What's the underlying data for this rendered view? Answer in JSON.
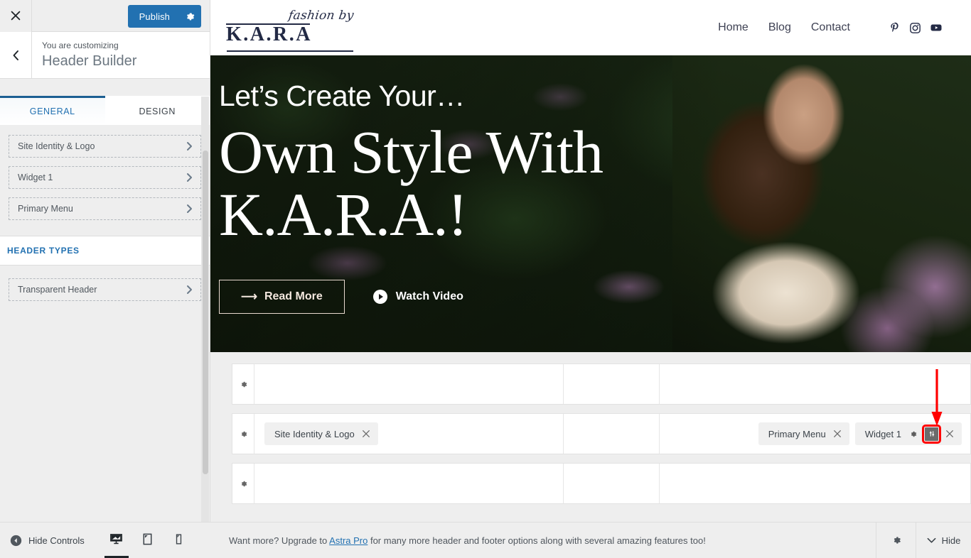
{
  "customizer": {
    "close_icon": "close-icon",
    "publish_label": "Publish",
    "publish_gear_icon": "gear-icon",
    "back_icon": "chevron-left-icon",
    "pretitle": "You are customizing",
    "title": "Header Builder",
    "tabs": [
      {
        "label": "GENERAL",
        "active": true
      },
      {
        "label": "DESIGN",
        "active": false
      }
    ],
    "items": [
      {
        "label": "Site Identity & Logo"
      },
      {
        "label": "Widget 1"
      },
      {
        "label": "Primary Menu"
      }
    ],
    "section_title": "HEADER TYPES",
    "type_items": [
      {
        "label": "Transparent Header"
      }
    ],
    "footer": {
      "hide_controls_label": "Hide Controls",
      "devices": [
        {
          "name": "desktop-preview",
          "icon": "desktop-icon",
          "active": true
        },
        {
          "name": "tablet-preview",
          "icon": "tablet-icon",
          "active": false
        },
        {
          "name": "mobile-preview",
          "icon": "mobile-icon",
          "active": false
        }
      ]
    }
  },
  "site": {
    "logo": {
      "script_text": "fashion by",
      "main_text": "K.A.R.A"
    },
    "nav": [
      {
        "label": "Home"
      },
      {
        "label": "Blog"
      },
      {
        "label": "Contact"
      }
    ],
    "socials": [
      {
        "name": "pinterest-icon"
      },
      {
        "name": "instagram-icon"
      },
      {
        "name": "youtube-icon"
      }
    ],
    "hero": {
      "eyebrow": "Let’s Create Your…",
      "title_line1": "Own Style With",
      "title_line2": "K.A.R.A.!",
      "primary_button": "Read More",
      "secondary_button": "Watch Video"
    }
  },
  "builder": {
    "rows": [
      {
        "name": "above-header-row",
        "gear_icon": "gear-icon",
        "left": [],
        "center": [],
        "right": []
      },
      {
        "name": "primary-header-row",
        "gear_icon": "gear-icon",
        "left": [
          {
            "label": "Site Identity & Logo",
            "actions": [
              "close-icon"
            ]
          }
        ],
        "center": [],
        "right": [
          {
            "label": "Primary Menu",
            "actions": [
              "close-icon"
            ]
          },
          {
            "label": "Widget 1",
            "actions": [
              "gear-icon",
              "widget-settings-icon",
              "close-icon"
            ],
            "highlight_action": 1
          }
        ]
      },
      {
        "name": "below-header-row",
        "gear_icon": "gear-icon",
        "left": [],
        "center": [],
        "right": []
      }
    ]
  },
  "preview_footer": {
    "message_prefix": "Want more? Upgrade to ",
    "link_label": "Astra Pro",
    "message_suffix": " for many more header and footer options along with several amazing features too!",
    "gear_icon": "gear-icon",
    "hide_label": "Hide",
    "hide_icon": "chevron-down-icon"
  },
  "annotation": {
    "arrow_color": "#ff0000",
    "highlight_color": "#ff0000"
  }
}
